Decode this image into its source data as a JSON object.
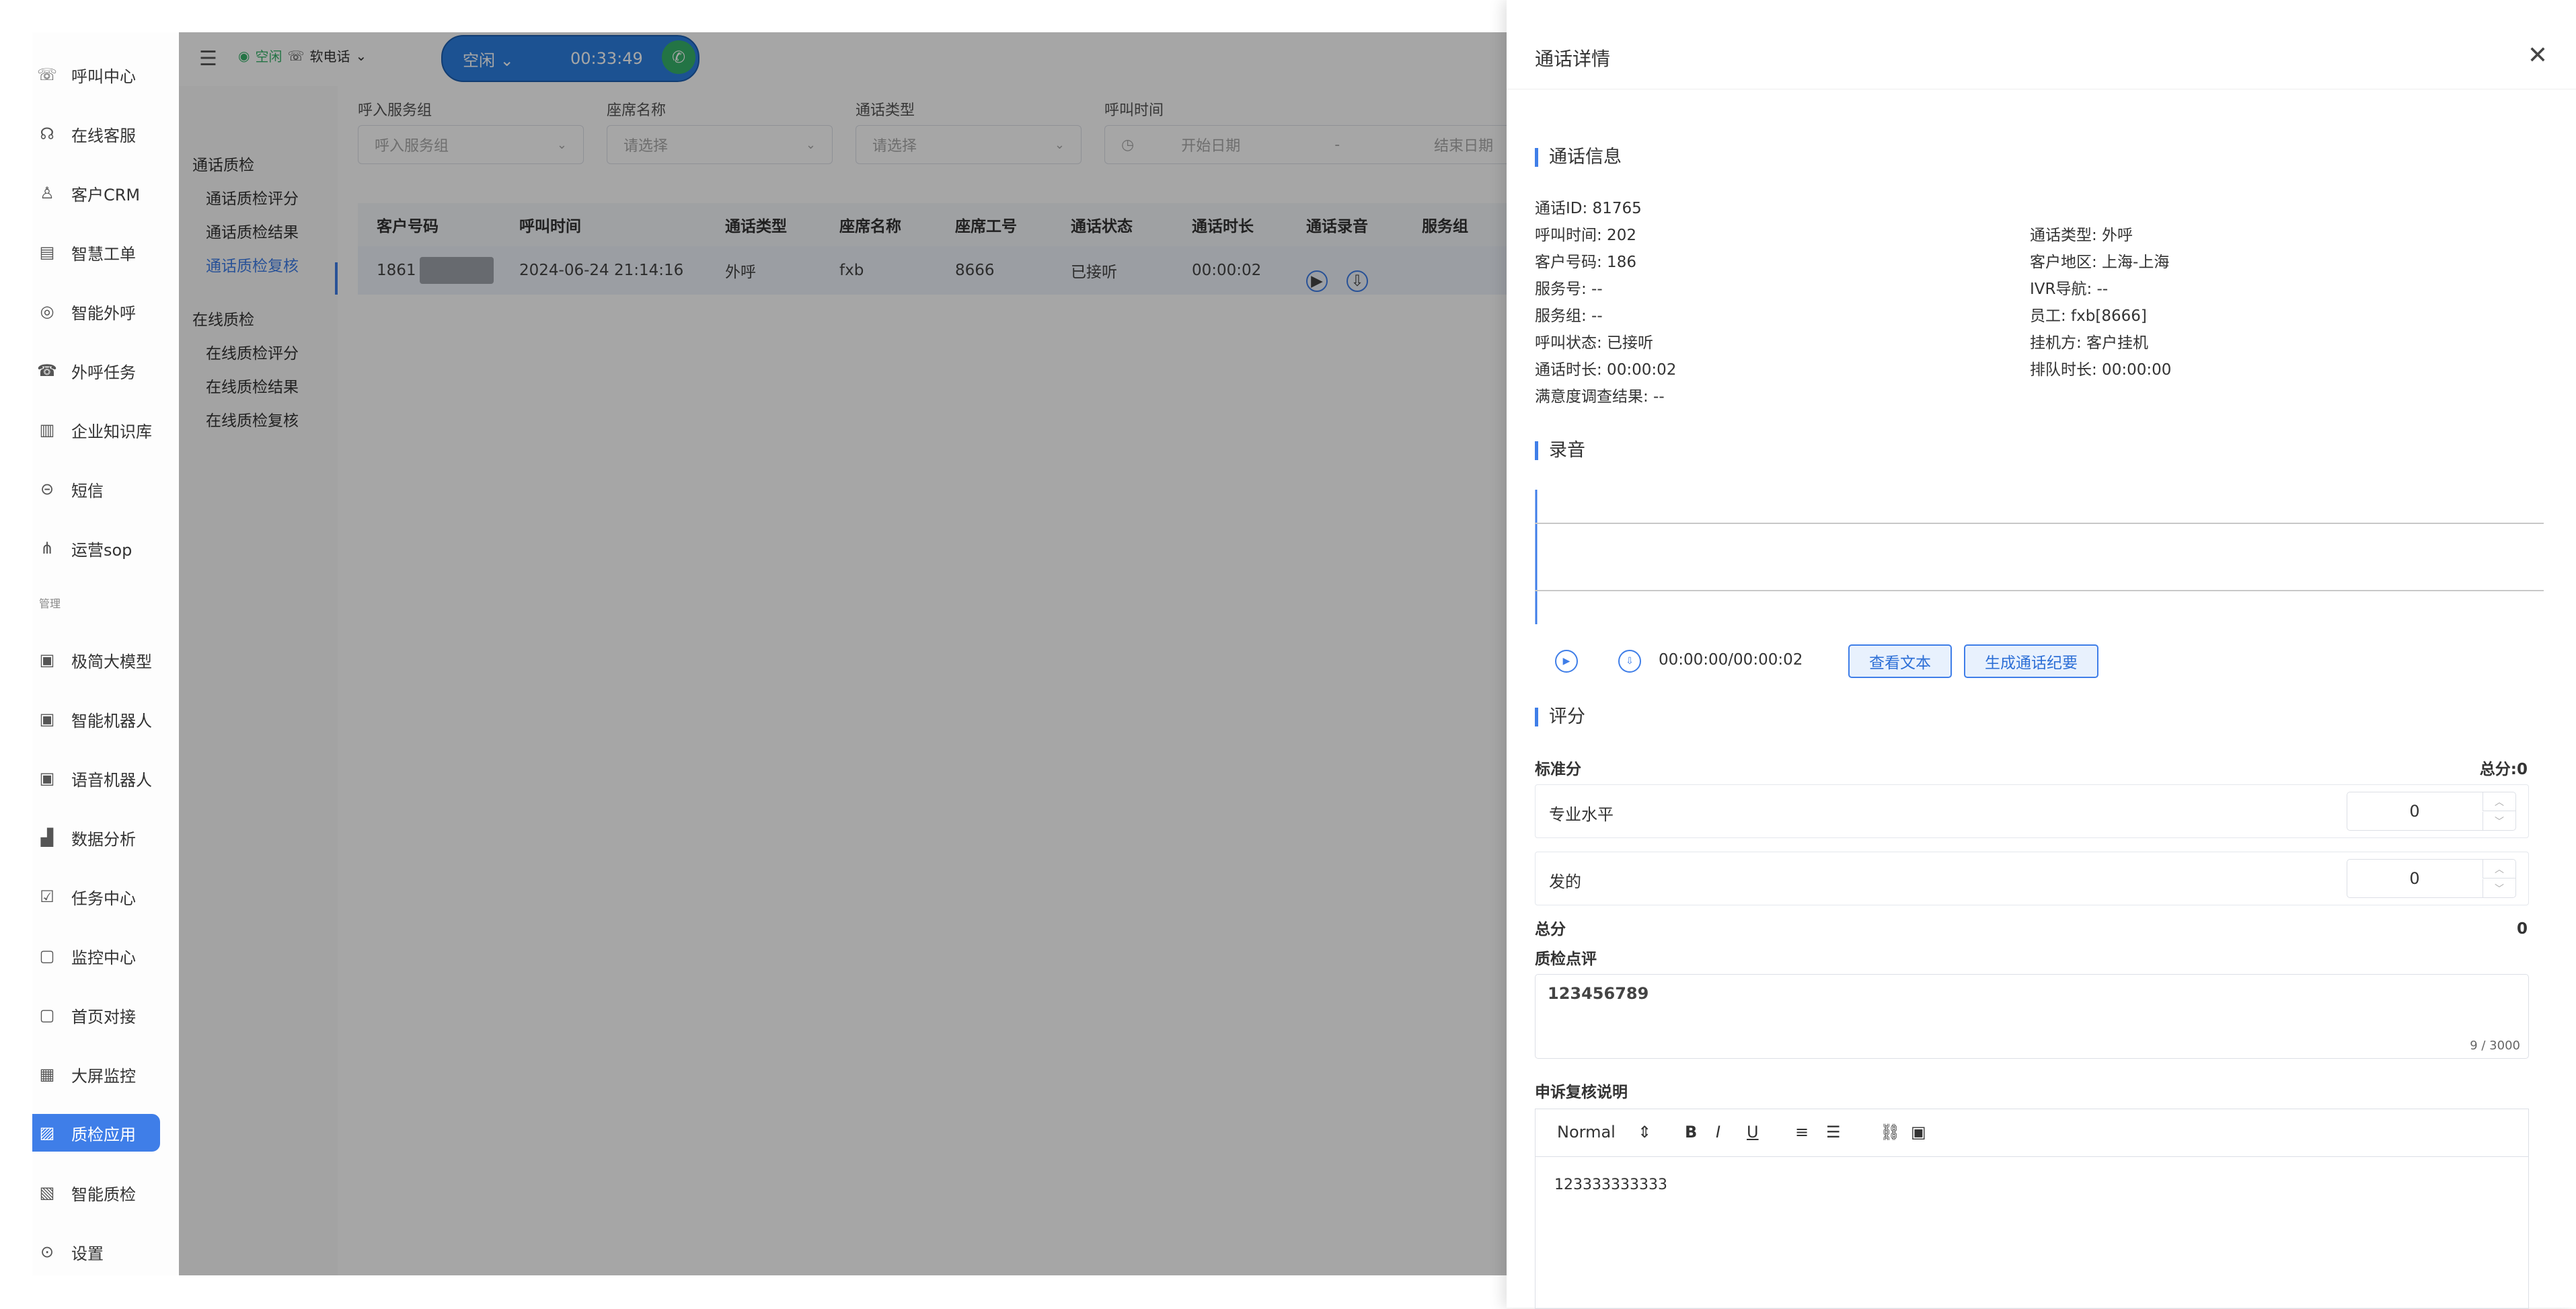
{
  "nav": {
    "items": [
      {
        "label": "呼叫中心",
        "icon": "phone-icon"
      },
      {
        "label": "在线客服",
        "icon": "headset-icon"
      },
      {
        "label": "客户CRM",
        "icon": "user-icon"
      },
      {
        "label": "智慧工单",
        "icon": "document-icon"
      },
      {
        "label": "智能外呼",
        "icon": "whatsapp-icon"
      },
      {
        "label": "外呼任务",
        "icon": "phone-wave-icon"
      },
      {
        "label": "企业知识库",
        "icon": "book-icon"
      },
      {
        "label": "短信",
        "icon": "message-icon"
      },
      {
        "label": "运营sop",
        "icon": "flow-icon"
      }
    ],
    "group_label": "管理",
    "items2": [
      {
        "label": "极简大模型",
        "icon": "model-icon"
      },
      {
        "label": "智能机器人",
        "icon": "robot-icon"
      },
      {
        "label": "语音机器人",
        "icon": "voice-robot-icon"
      },
      {
        "label": "数据分析",
        "icon": "chart-icon"
      },
      {
        "label": "任务中心",
        "icon": "task-icon"
      },
      {
        "label": "监控中心",
        "icon": "monitor-icon"
      },
      {
        "label": "首页对接",
        "icon": "dock-icon"
      },
      {
        "label": "大屏监控",
        "icon": "screen-icon"
      },
      {
        "label": "质检应用",
        "icon": "qc-icon",
        "active": true
      },
      {
        "label": "智能质检",
        "icon": "smart-qc-icon"
      },
      {
        "label": "设置",
        "icon": "settings-icon"
      }
    ]
  },
  "subnav": {
    "g1": "通话质检",
    "s1": "通话质检评分",
    "s2": "通话质检结果",
    "s3": "通话质检复核",
    "g2": "在线质检",
    "s4": "在线质检评分",
    "s5": "在线质检结果",
    "s6": "在线质检复核"
  },
  "topbar": {
    "status_small": "空闲",
    "phone": "软电话",
    "pill_status": "空闲",
    "timer": "00:33:49"
  },
  "filters": {
    "f1_label": "呼入服务组",
    "f1_ph": "呼入服务组",
    "f2_label": "座席名称",
    "f2_ph": "请选择",
    "f3_label": "通话类型",
    "f3_ph": "请选择",
    "f4_label": "呼叫时间",
    "start": "开始日期",
    "sep": "-",
    "end": "结束日期"
  },
  "table": {
    "headers": [
      "客户号码",
      "呼叫时间",
      "通话类型",
      "座席名称",
      "座席工号",
      "通话状态",
      "通话时长",
      "通话录音",
      "服务组"
    ],
    "row": {
      "phone": "1861",
      "time": "2024-06-24 21:14:16",
      "type": "外呼",
      "agent": "fxb",
      "agent_id": "8666",
      "status": "已接听",
      "duration": "00:00:02"
    }
  },
  "drawer": {
    "title": "通话详情",
    "sec_info": "通话信息",
    "info_left": [
      "通话ID: 81765",
      "呼叫时间: 202",
      "客户号码: 186",
      "服务号: --",
      "服务组: --",
      "呼叫状态: 已接听",
      "通话时长: 00:00:02",
      "满意度调查结果: --"
    ],
    "info_right": [
      "通话类型: 外呼",
      "客户地区: 上海-上海",
      "IVR导航: --",
      "员工: fxb[8666]",
      "挂机方: 客户挂机",
      "排队时长: 00:00:00"
    ],
    "sec_rec": "录音",
    "time": "00:00:00/00:00:02",
    "btn_text": "查看文本",
    "btn_summary": "生成通话纪要",
    "sec_score": "评分",
    "std": "标准分",
    "total_label": "总分:0",
    "scores": [
      {
        "name": "专业水平",
        "value": "0"
      },
      {
        "name": "发的",
        "value": "0"
      }
    ],
    "sum_label": "总分",
    "sum_value": "0",
    "comment_label": "质检点评",
    "comment": "123456789",
    "count": "9 / 3000",
    "appeal_label": "申诉复核说明",
    "editor_format": "Normal",
    "editor_body": "123333333333"
  }
}
